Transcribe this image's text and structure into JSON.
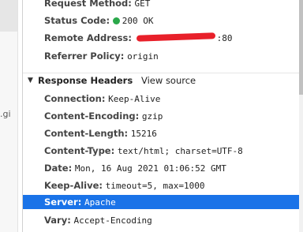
{
  "left_fragment": {
    "text": ".gi"
  },
  "general": {
    "request_method_key": "Request Method:",
    "request_method_val": "GET",
    "status_code_key": "Status Code:",
    "status_code_val": "200 OK",
    "remote_address_key": "Remote Address:",
    "remote_address_val": ":80",
    "referrer_policy_key": "Referrer Policy:",
    "referrer_policy_val": "origin"
  },
  "response_headers": {
    "title": "Response Headers",
    "view_source": "View source",
    "items": [
      {
        "key": "Connection:",
        "val": "Keep-Alive"
      },
      {
        "key": "Content-Encoding:",
        "val": "gzip"
      },
      {
        "key": "Content-Length:",
        "val": "15216"
      },
      {
        "key": "Content-Type:",
        "val": "text/html; charset=UTF-8"
      },
      {
        "key": "Date:",
        "val": "Mon, 16 Aug 2021 01:06:52 GMT"
      },
      {
        "key": "Keep-Alive:",
        "val": "timeout=5, max=1000"
      },
      {
        "key": "Server:",
        "val": "Apache"
      },
      {
        "key": "Vary:",
        "val": "Accept-Encoding"
      }
    ]
  },
  "colors": {
    "selected_row": "#1a73e8",
    "status_dot": "#2aa84a",
    "redaction": "#e8202a"
  }
}
